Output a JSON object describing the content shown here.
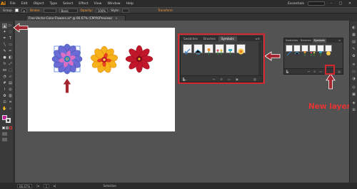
{
  "app": {
    "logo": "Ai",
    "essentials": "Essentials"
  },
  "menu": [
    "File",
    "Edit",
    "Object",
    "Type",
    "Select",
    "Effect",
    "View",
    "Window",
    "Help"
  ],
  "control_bar": {
    "selection": "Group",
    "stroke_label": "Stroke:",
    "brush": "Basic",
    "opacity_label": "Opacity:",
    "opacity": "100%",
    "style_label": "Style:",
    "transform": "Transform"
  },
  "document": {
    "tab_title": "Free-Vector-Color-Flowers.ai* @ 66.67% (CMYK/Preview)",
    "close": "×"
  },
  "symbols_panel_large": {
    "tabs": [
      "Swatches",
      "Brushes",
      "Symbols"
    ],
    "active": 2,
    "symbol_count": 6
  },
  "symbols_panel_small": {
    "tabs": [
      "Swatches",
      "Brushes",
      "Symbols"
    ],
    "active": 2,
    "symbol_count": 6
  },
  "annotation": {
    "new_layer_label": "New layer"
  },
  "status": {
    "zoom": "66.67%",
    "page": "1",
    "mode": "Selection"
  },
  "colors": {
    "highlight": "#d4262f",
    "annotation_text": "#e53434",
    "arrow": "#a42631"
  },
  "icons": [
    "selection-tool-icon",
    "new-symbol-icon",
    "delete-icon",
    "arrow-icon"
  ]
}
